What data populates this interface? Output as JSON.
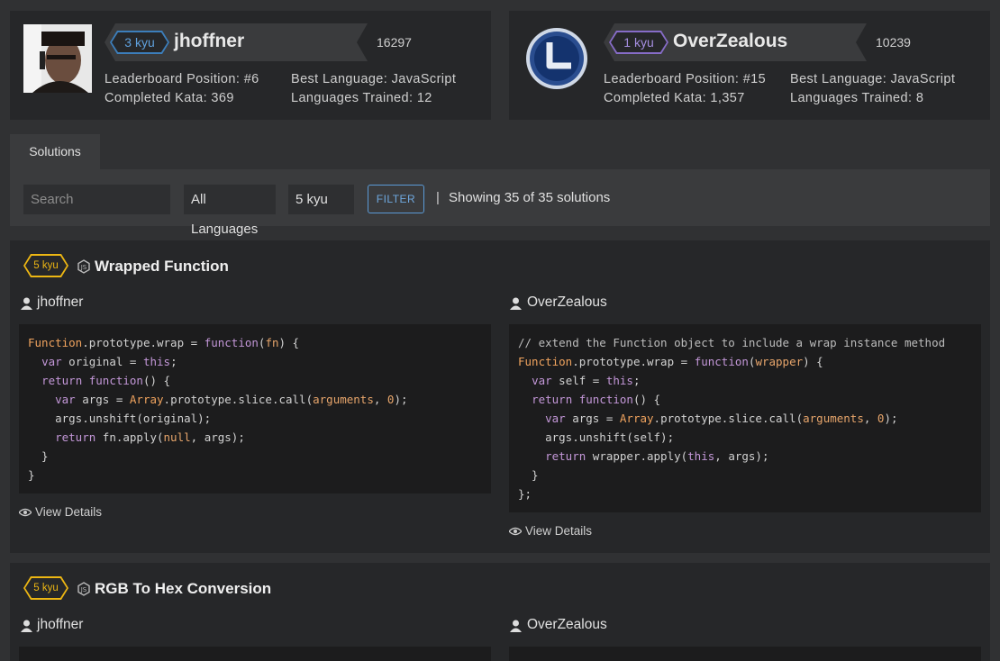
{
  "users": [
    {
      "username": "jhoffner",
      "rank": "3 kyu",
      "rank_color": "#3c7ebb",
      "honor": "16297",
      "leaderboard": "Leaderboard Position: #6",
      "completed": "Completed Kata: 369",
      "best_language": "Best Language: JavaScript",
      "languages_trained": "Languages Trained: 12"
    },
    {
      "username": "OverZealous",
      "rank": "1 kyu",
      "rank_color": "#866cc7",
      "honor": "10239",
      "leaderboard": "Leaderboard Position: #15",
      "completed": "Completed Kata: 1,357",
      "best_language": "Best Language: JavaScript",
      "languages_trained": "Languages Trained: 8"
    }
  ],
  "tabs": {
    "solutions": "Solutions"
  },
  "filters": {
    "search_placeholder": "Search",
    "language": "All Languages",
    "rank": "5 kyu",
    "filter_button": "FILTER",
    "separator": "|",
    "showing": "Showing 35 of 35 solutions"
  },
  "katas": [
    {
      "rank": "5 kyu",
      "title": "Wrapped Function",
      "left_author": "jhoffner",
      "right_author": "OverZealous",
      "view_details": "View Details"
    },
    {
      "rank": "5 kyu",
      "title": "RGB To Hex Conversion",
      "left_author": "jhoffner",
      "right_author": "OverZealous"
    }
  ],
  "colors": {
    "kyu_yellow": "#ecb613",
    "filter_blue": "#5b9ad6"
  }
}
